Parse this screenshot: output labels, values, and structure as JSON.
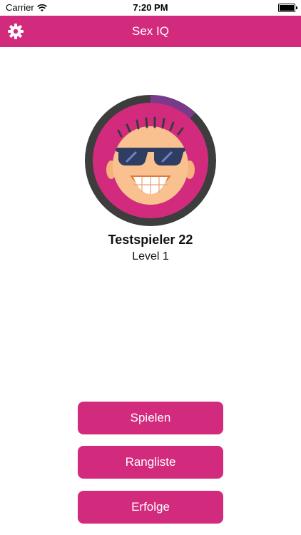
{
  "status_bar": {
    "carrier": "Carrier",
    "time": "7:20 PM"
  },
  "nav": {
    "title": "Sex IQ",
    "settings_icon": "gear-icon"
  },
  "player": {
    "name": "Testspieler 22",
    "level": "Level 1",
    "progress_fraction": 0.12
  },
  "buttons": {
    "play": "Spielen",
    "ranking": "Rangliste",
    "achievements": "Erfolge"
  },
  "colors": {
    "accent": "#d22b7e",
    "ring": "#3d3d3d",
    "progress": "#7a3a8c"
  }
}
